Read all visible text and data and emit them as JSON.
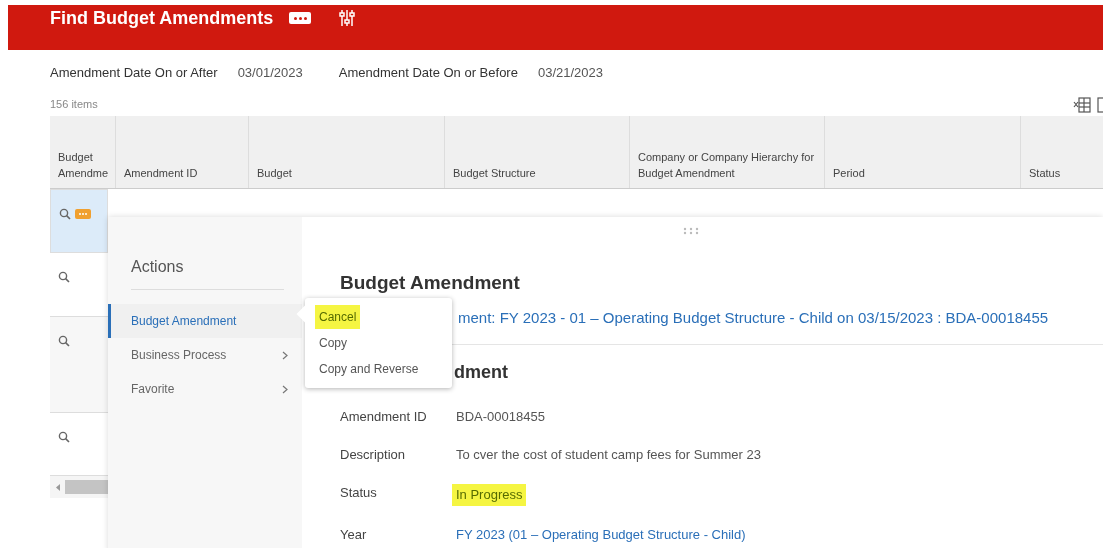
{
  "header": {
    "title": "Find Budget Amendments"
  },
  "filters": [
    {
      "label": "Amendment Date On or After",
      "value": "03/01/2023"
    },
    {
      "label": "Amendment Date On or Before",
      "value": "03/21/2023"
    }
  ],
  "item_count": "156 items",
  "table": {
    "columns": [
      "Budget Amendme",
      "Amendment ID",
      "Budget",
      "Budget Structure",
      "Company or Company Hierarchy for Budget Amendment",
      "Period",
      "Status"
    ],
    "rows": [
      {
        "selected": true,
        "actions_button": true
      },
      {
        "selected": false,
        "actions_button": false
      },
      {
        "selected": false,
        "actions_button": false
      },
      {
        "selected": false,
        "actions_button": false
      }
    ]
  },
  "actions_menu": {
    "title": "Actions",
    "items": [
      {
        "label": "Budget Amendment",
        "selected": true,
        "has_submenu": false
      },
      {
        "label": "Business Process",
        "selected": false,
        "has_submenu": true
      },
      {
        "label": "Favorite",
        "selected": false,
        "has_submenu": true
      }
    ]
  },
  "submenu": {
    "items": [
      {
        "label": "Cancel",
        "highlighted": true
      },
      {
        "label": "Copy",
        "highlighted": false
      },
      {
        "label": "Copy and Reverse",
        "highlighted": false
      }
    ]
  },
  "detail": {
    "title": "Budget Amendment",
    "link": "ment: FY 2023 - 01 – Operating Budget Structure - Child on 03/15/2023 : BDA-00018455",
    "section_title": "dment",
    "fields": [
      {
        "label": "Amendment ID",
        "value": "BDA-00018455",
        "kind": "text",
        "highlighted": false
      },
      {
        "label": "Description",
        "value": "To cver the cost of student camp fees for Summer 23",
        "kind": "text",
        "highlighted": false
      },
      {
        "label": "Status",
        "value": "In Progress",
        "kind": "text",
        "highlighted": true
      },
      {
        "label": "Year",
        "value": "FY 2023 (01 – Operating Budget Structure - Child)",
        "kind": "link",
        "highlighted": false
      }
    ]
  }
}
